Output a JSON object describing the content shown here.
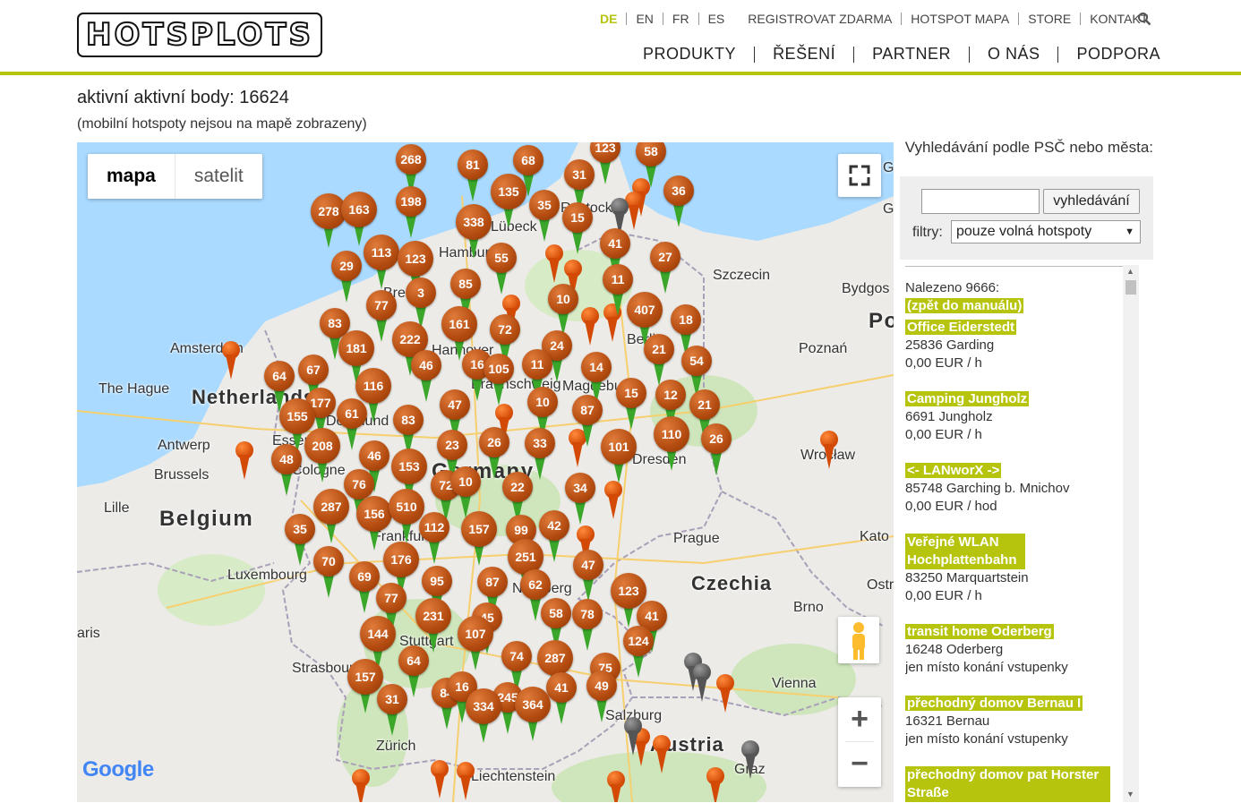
{
  "header": {
    "logo_text": "HOTSPLOTS",
    "languages": [
      "DE",
      "EN",
      "FR",
      "ES"
    ],
    "active_language": "DE",
    "top_links": [
      "REGISTROVAT ZDARMA",
      "HOTSPOT MAPA",
      "STORE",
      "KONTAKT"
    ],
    "main_nav": [
      "PRODUKTY",
      "ŘEŠENÍ",
      "PARTNER",
      "O NÁS",
      "PODPORA"
    ],
    "search_icon": "search-icon",
    "accent_color": "#b7c40e"
  },
  "page": {
    "title": "aktivní aktivní body: 16624",
    "subtitle": "(mobilní hotspoty nejsou na mapě zobrazeny)"
  },
  "map": {
    "type_buttons": [
      "mapa",
      "satelit"
    ],
    "active_type": "mapa",
    "zoom_in": "+",
    "zoom_out": "−",
    "provider": "Google",
    "cities": [
      "Amsterdam",
      "The Hague",
      "Netherlands",
      "Antwerp",
      "Brussels",
      "Belgium",
      "Lille",
      "Luxembourg",
      "aris",
      "Strasbourg",
      "Zürich",
      "Liechtenstein",
      "Hamburg",
      "Lübeck",
      "Rostock",
      "Bremen",
      "Hannover",
      "Braunschweig",
      "Magdeburg",
      "Berlin",
      "Szczecin",
      "Bydgos",
      "Poznań",
      "Dresden",
      "Wrocław",
      "Prague",
      "Czechia",
      "Kato",
      "Ostr",
      "Brno",
      "Vienna",
      "Graz",
      "Salzburg",
      "Austria",
      "Nürnberg",
      "Stuttgart",
      "Frankfurt",
      "Cologne",
      "Essen",
      "Dortmund",
      "Germany",
      "Pol",
      "G",
      "G"
    ],
    "clusters": [
      "268",
      "81",
      "68",
      "123",
      "58",
      "31",
      "135",
      "35",
      "15",
      "36",
      "278",
      "163",
      "198",
      "338",
      "41",
      "29",
      "113",
      "123",
      "55",
      "27",
      "11",
      "85",
      "3",
      "77",
      "10",
      "407",
      "18",
      "83",
      "161",
      "72",
      "181",
      "222",
      "24",
      "21",
      "54",
      "64",
      "67",
      "116",
      "46",
      "16",
      "105",
      "11",
      "14",
      "177",
      "15",
      "12",
      "155",
      "61",
      "83",
      "47",
      "10",
      "87",
      "21",
      "208",
      "23",
      "26",
      "33",
      "110",
      "101",
      "26",
      "48",
      "46",
      "153",
      "72",
      "10",
      "22",
      "34",
      "76",
      "287",
      "156",
      "510",
      "112",
      "157",
      "99",
      "42",
      "35",
      "251",
      "70",
      "176",
      "47",
      "69",
      "95",
      "87",
      "62",
      "123",
      "77",
      "231",
      "45",
      "58",
      "78",
      "41",
      "144",
      "107",
      "124",
      "64",
      "74",
      "287",
      "75",
      "157",
      "84",
      "16",
      "245",
      "41",
      "49",
      "31",
      "334",
      "364"
    ]
  },
  "sidebar": {
    "search_label": "Vyhledávání podle PSČ nebo města:",
    "search_value": "",
    "search_button": "vyhledávání",
    "filter_label": "filtry:",
    "filter_value": "pouze volná hotspoty",
    "found": "Nalezeno 9666:",
    "back": "(zpět do manuálu)",
    "results": [
      {
        "name": "Office Eiderstedt",
        "line2": "25836 Garding",
        "line3": "0,00 EUR / h"
      },
      {
        "name": "Camping Jungholz",
        "line2": "6691 Jungholz",
        "line3": "0,00 EUR / h"
      },
      {
        "name": "<- LANworX ->",
        "line2": "85748 Garching b. Mnichov",
        "line3": "0,00 EUR / hod"
      },
      {
        "name": "Veřejné WLAN Hochplattenbahn",
        "line2": "83250 Marquartstein",
        "line3": "0,00 EUR / h"
      },
      {
        "name": "transit home Oderberg",
        "line2": "16248 Oderberg",
        "line3": "jen místo konání vstupenky"
      },
      {
        "name": "přechodný domov Bernau I",
        "line2": "16321 Bernau",
        "line3": "jen místo konání vstupenky"
      },
      {
        "name": "přechodný domov pat Horster Straße",
        "line2": "",
        "line3": ""
      }
    ]
  }
}
